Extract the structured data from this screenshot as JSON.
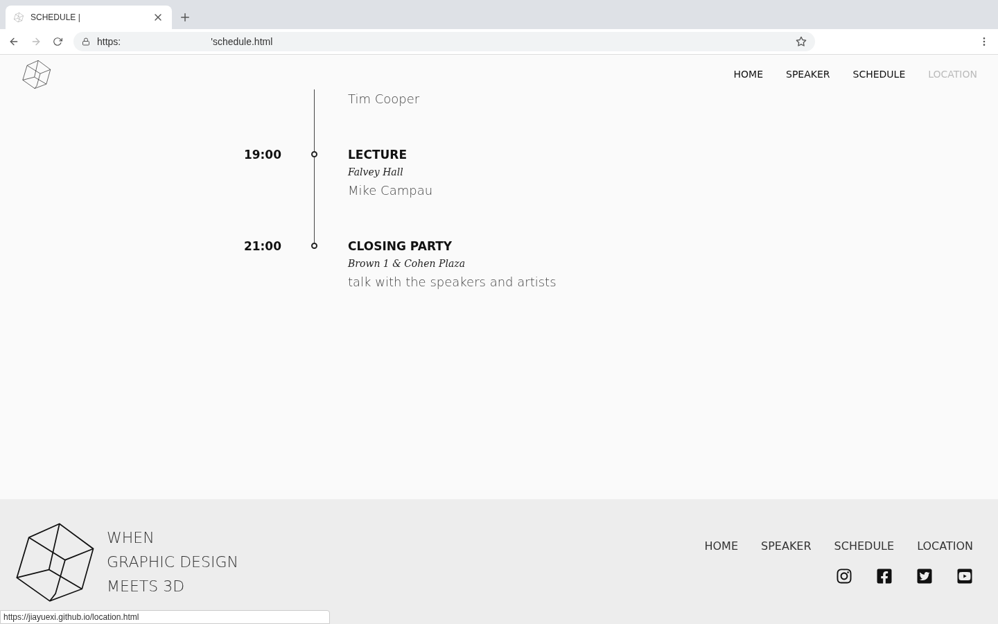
{
  "browser": {
    "tab_title": "SCHEDULE |",
    "url_scheme": "https:",
    "url_path": "'schedule.html",
    "status_url": "https://jiayuexi.github.io/location.html"
  },
  "nav": [
    {
      "label": "HOME",
      "hovered": false
    },
    {
      "label": "SPEAKER",
      "hovered": false
    },
    {
      "label": "SCHEDULE",
      "hovered": false
    },
    {
      "label": "LOCATION",
      "hovered": true
    }
  ],
  "schedule": [
    {
      "speaker": "Tim Cooper"
    },
    {
      "time": "19:00",
      "title": "LECTURE",
      "venue": "Falvey Hall",
      "speaker": "Mike Campau"
    },
    {
      "time": "21:00",
      "title": "CLOSING PARTY",
      "venue": "Brown 1 & Cohen Plaza",
      "speaker": "talk with the speakers and artists"
    }
  ],
  "footer": {
    "tagline": [
      "WHEN",
      "GRAPHIC DESIGN",
      "MEETS 3D"
    ],
    "nav": [
      "HOME",
      "SPEAKER",
      "SCHEDULE",
      "LOCATION"
    ],
    "social": [
      {
        "kind": "instagram"
      },
      {
        "kind": "facebook"
      },
      {
        "kind": "twitter"
      },
      {
        "kind": "youtube"
      }
    ]
  }
}
